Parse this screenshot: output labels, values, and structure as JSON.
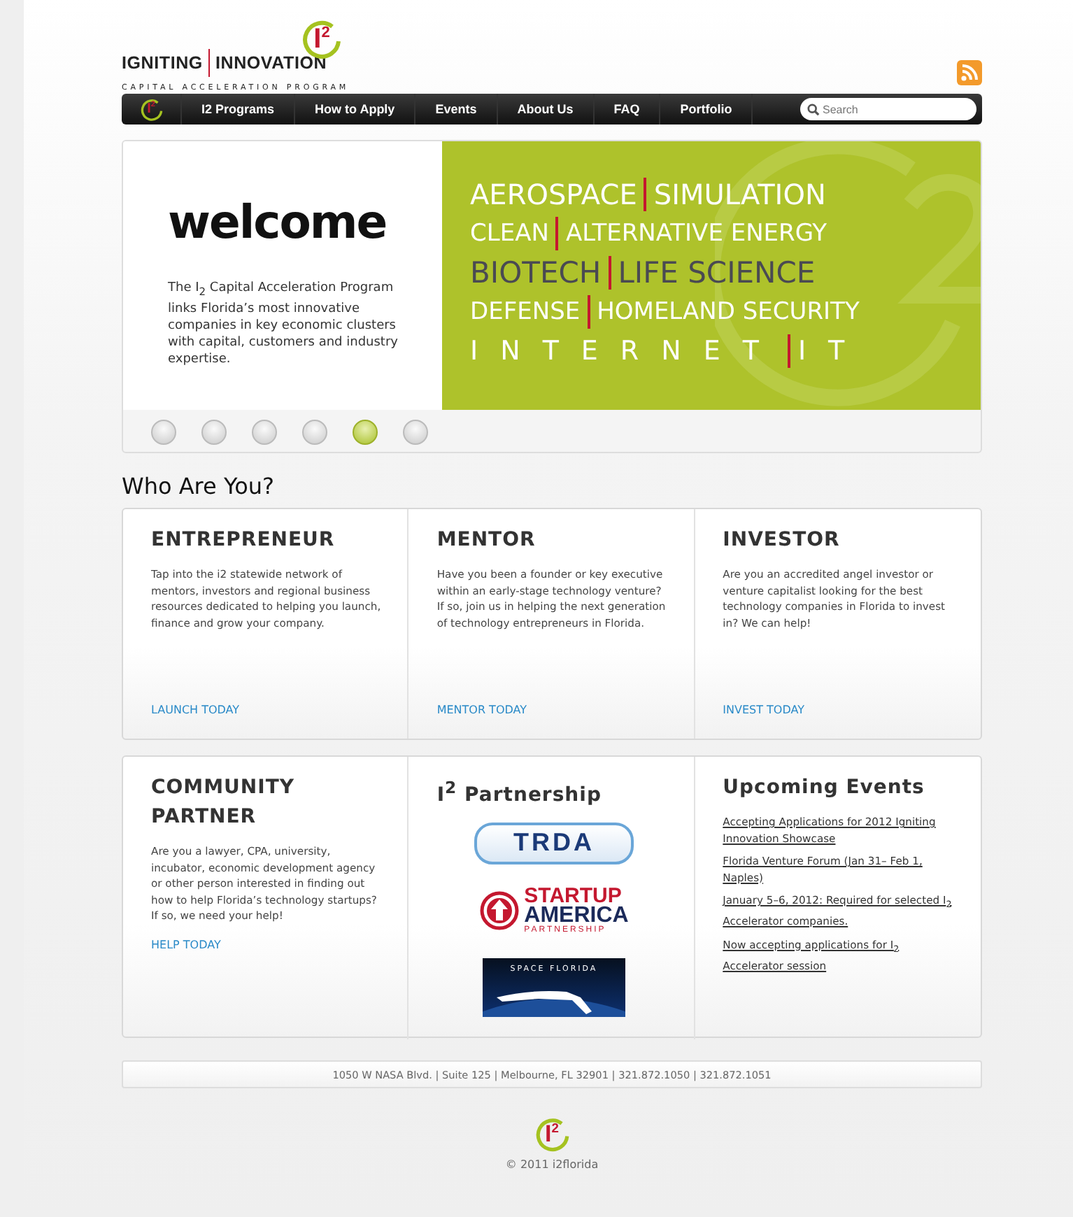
{
  "header": {
    "logo": {
      "mark": "I",
      "mark_sup": "2",
      "left": "IGNITING",
      "right": "INNOVATION",
      "tagline": "CAPITAL ACCELERATION PROGRAM"
    }
  },
  "nav": {
    "home_mark": "I",
    "home_sup": "2",
    "items": [
      {
        "label": "I2 Programs"
      },
      {
        "label": "How to Apply"
      },
      {
        "label": "Events"
      },
      {
        "label": "About Us"
      },
      {
        "label": "FAQ"
      },
      {
        "label": "Portfolio"
      }
    ],
    "search": {
      "placeholder": "Search"
    }
  },
  "banner": {
    "title": "welcome",
    "text": "The I$_{2}$ Capital Acceleration Program links Florida’s most innovative companies in key economic clusters with capital, customers and industry expertise.",
    "lines": [
      {
        "kind": "light",
        "left": "AEROSPACE",
        "right": "SIMULATION"
      },
      {
        "kind": "light",
        "left": "CLEAN",
        "right": "ALTERNATIVE ENERGY"
      },
      {
        "kind": "dark",
        "left": "BIOTECH",
        "right": "LIFE SCIENCE"
      },
      {
        "kind": "light",
        "left": "DEFENSE",
        "right": "HOMELAND SECURITY"
      },
      {
        "kind": "spaced",
        "left": "INTERNET",
        "right": "IT"
      }
    ],
    "slides": [
      {
        "selected": false
      },
      {
        "selected": false
      },
      {
        "selected": false
      },
      {
        "selected": false
      },
      {
        "selected": true
      },
      {
        "selected": false
      }
    ]
  },
  "who": {
    "title": "Who Are You?",
    "cards": [
      {
        "title": "ENTREPRENEUR",
        "text": "Tap into the i2 statewide network of mentors, investors and regional business resources dedicated to helping you launch, finance and grow your company.",
        "link": "LAUNCH TODAY"
      },
      {
        "title": "MENTOR",
        "text": "Have you been a founder or key executive within an early-stage technology venture? If so, join us in helping the next generation of technology entrepreneurs in Florida.",
        "link": "MENTOR TODAY"
      },
      {
        "title": "INVESTOR",
        "text": "Are you an accredited angel investor or venture capitalist looking for the best technology companies in Florida to invest in? We can help!",
        "link": "INVEST TODAY"
      }
    ]
  },
  "community": {
    "title": "COMMUNITY PARTNER",
    "text": "Are you a lawyer, CPA, university, incubator, economic development agency or other person interested in finding out how to help Florida’s technology startups? If so, we need your help!",
    "link": "HELP TODAY"
  },
  "partnership": {
    "title": "I$^{2}$ Partnership",
    "partners": [
      {
        "kind": "trda",
        "name": "TRDA"
      },
      {
        "kind": "startup",
        "name": "STARTUP",
        "name2": "AMERICA",
        "name3": "PARTNERSHIP"
      },
      {
        "kind": "space",
        "name": "SPACE FLORIDA"
      }
    ]
  },
  "events": {
    "title": "Upcoming Events",
    "items": [
      {
        "text": "Accepting Applications for 2012 Igniting Innovation Showcase"
      },
      {
        "text": "Florida Venture Forum (Jan 31– Feb 1, Naples)"
      },
      {
        "text": "January 5–6, 2012: Required for selected I$_{2}$ Accelerator companies."
      },
      {
        "text": "Now accepting applications for I$_{2}$ Accelerator session"
      }
    ]
  },
  "footer": {
    "address": "1050 W NASA Blvd. | Suite 125 | Melbourne, FL 32901 | 321.872.1050 | 321.872.1051",
    "mark": "I",
    "mark_sup": "2",
    "copyright": "© 2011 i2florida"
  }
}
